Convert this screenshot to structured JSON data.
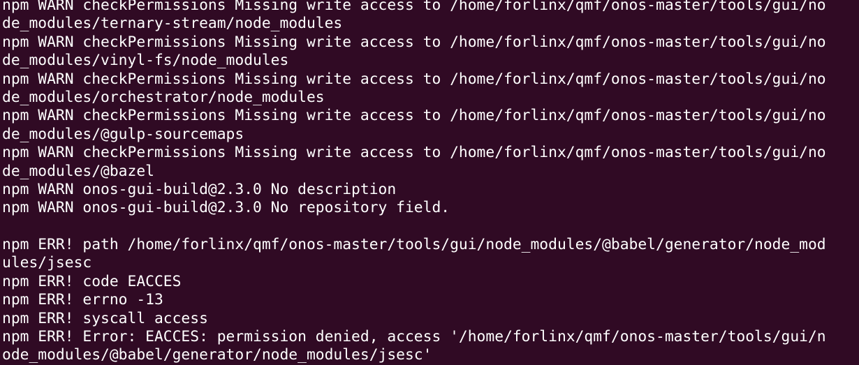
{
  "terminal": {
    "lines": [
      "npm WARN checkPermissions Missing write access to /home/forlinx/qmf/onos-master/tools/gui/no",
      "de_modules/ternary-stream/node_modules",
      "npm WARN checkPermissions Missing write access to /home/forlinx/qmf/onos-master/tools/gui/no",
      "de_modules/vinyl-fs/node_modules",
      "npm WARN checkPermissions Missing write access to /home/forlinx/qmf/onos-master/tools/gui/no",
      "de_modules/orchestrator/node_modules",
      "npm WARN checkPermissions Missing write access to /home/forlinx/qmf/onos-master/tools/gui/no",
      "de_modules/@gulp-sourcemaps",
      "npm WARN checkPermissions Missing write access to /home/forlinx/qmf/onos-master/tools/gui/no",
      "de_modules/@bazel",
      "npm WARN onos-gui-build@2.3.0 No description",
      "npm WARN onos-gui-build@2.3.0 No repository field.",
      "",
      "npm ERR! path /home/forlinx/qmf/onos-master/tools/gui/node_modules/@babel/generator/node_mod",
      "ules/jsesc",
      "npm ERR! code EACCES",
      "npm ERR! errno -13",
      "npm ERR! syscall access",
      "npm ERR! Error: EACCES: permission denied, access '/home/forlinx/qmf/onos-master/tools/gui/n",
      "ode_modules/@babel/generator/node_modules/jsesc'"
    ]
  },
  "colors": {
    "background": "#300a24",
    "foreground": "#ffffff"
  }
}
